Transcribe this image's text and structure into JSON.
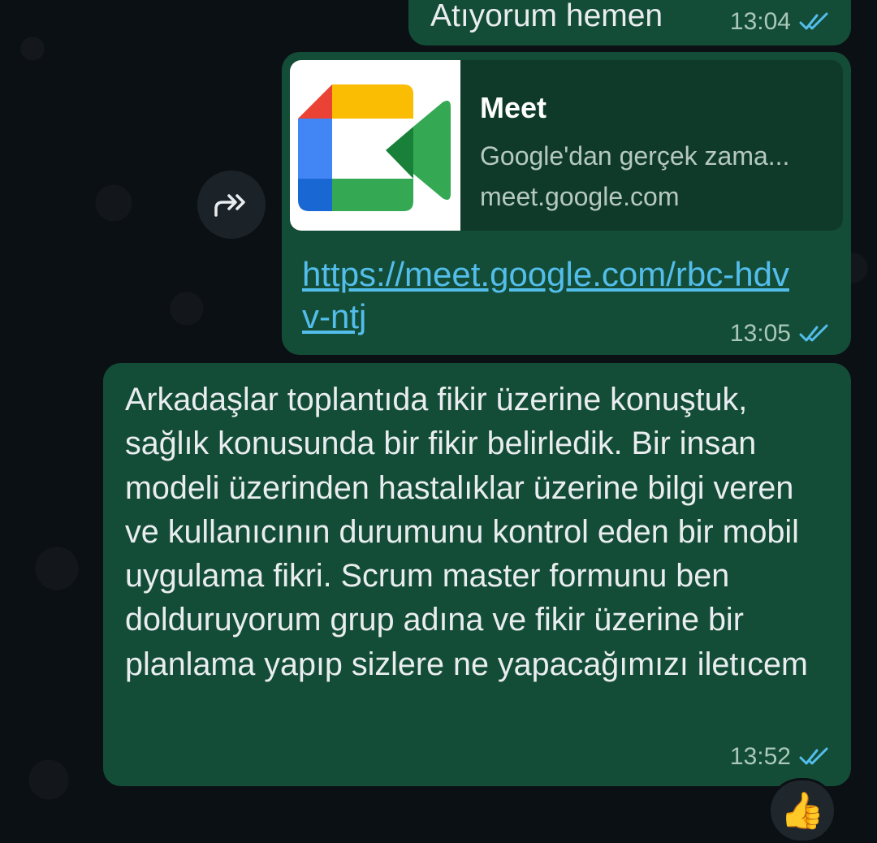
{
  "colors": {
    "outgoing_bubble": "#144d37",
    "link": "#53bdeb",
    "read_ticks": "#53bdeb",
    "chat_background": "#0b1014"
  },
  "messages": [
    {
      "text": "Atıyorum hemen",
      "time": "13:04",
      "status": "read-double-check-icon"
    },
    {
      "preview": {
        "title": "Meet",
        "description": "Google'dan gerçek zama...",
        "domain": "meet.google.com",
        "thumbnail": "google-meet-logo-icon"
      },
      "link": "https://meet.google.com/rbc-hdvv-ntj",
      "time": "13:05",
      "status": "read-double-check-icon"
    },
    {
      "text": "Arkadaşlar toplantıda fikir üzerine konuştuk, sağlık konusunda bir fikir belirledik. Bir insan modeli üzerinden hastalıklar üzerine bilgi veren ve kullanıcının durumunu kontrol eden bir mobil uygulama fikri. Scrum master formunu ben dolduruyorum grup adına ve fikir üzerine bir planlama yapıp sizlere ne yapacağımızı iletıcem",
      "time": "13:52",
      "status": "read-double-check-icon",
      "reaction": "👍"
    }
  ],
  "forward_button": {
    "icon": "forward-icon"
  }
}
